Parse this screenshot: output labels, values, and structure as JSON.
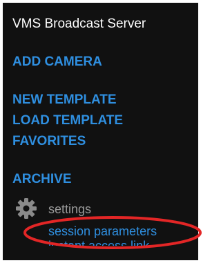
{
  "app": {
    "title": "VMS Broadcast Server"
  },
  "nav": {
    "add_camera": "ADD CAMERA",
    "new_template": "NEW TEMPLATE",
    "load_template": "LOAD TEMPLATE",
    "favorites": "FAVORITES",
    "archive": "ARCHIVE"
  },
  "settings": {
    "icon": "gear-icon",
    "label": "settings",
    "items": [
      "session parameters",
      "instant access link"
    ]
  },
  "colors": {
    "background": "#111111",
    "link": "#2f8fe0",
    "title": "#ffffff",
    "muted": "#9a9a9a",
    "highlight": "#e32626"
  }
}
